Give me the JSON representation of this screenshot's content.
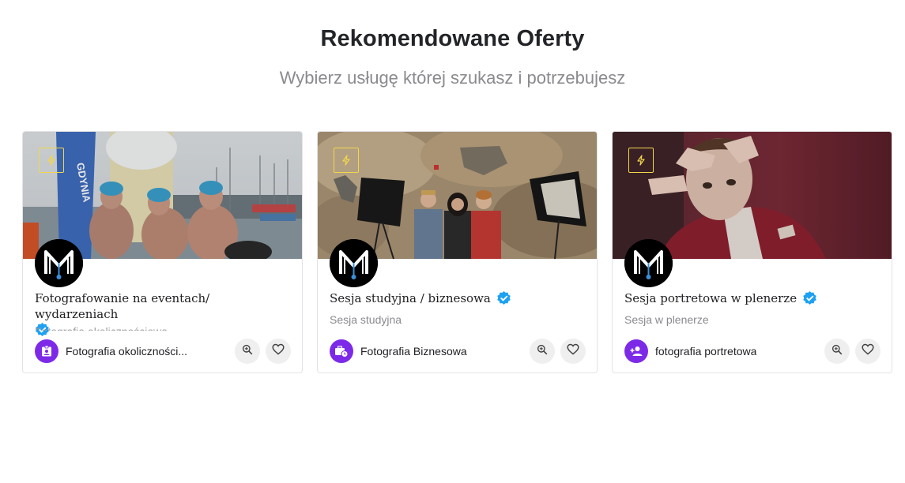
{
  "section": {
    "title": "Rekomendowane Oferty",
    "subtitle": "Wybierz usługę której szukasz i potrzebujesz"
  },
  "colors": {
    "category_icon_bg": "#7d2ae8",
    "verified_badge": "#1da1f2",
    "promo_border": "#f2d64b"
  },
  "cards": [
    {
      "title": "Fotografowanie na eventach/ wydarzeniach",
      "subtitle": "Fotografia okolicznościowa",
      "category": "Fotografia okoliczności...",
      "category_icon": "badge-portrait-icon",
      "image_sign_text": "GDYNIA",
      "verified": true
    },
    {
      "title": "Sesja studyjna / biznesowa",
      "subtitle": "Sesja studyjna",
      "category": "Fotografia Biznesowa",
      "category_icon": "briefcase-clock-icon",
      "verified": true
    },
    {
      "title": "Sesja portretowa w plenerze",
      "subtitle": "Sesja w plenerze",
      "category": "fotografia portretowa",
      "category_icon": "person-add-icon",
      "verified": true
    }
  ]
}
